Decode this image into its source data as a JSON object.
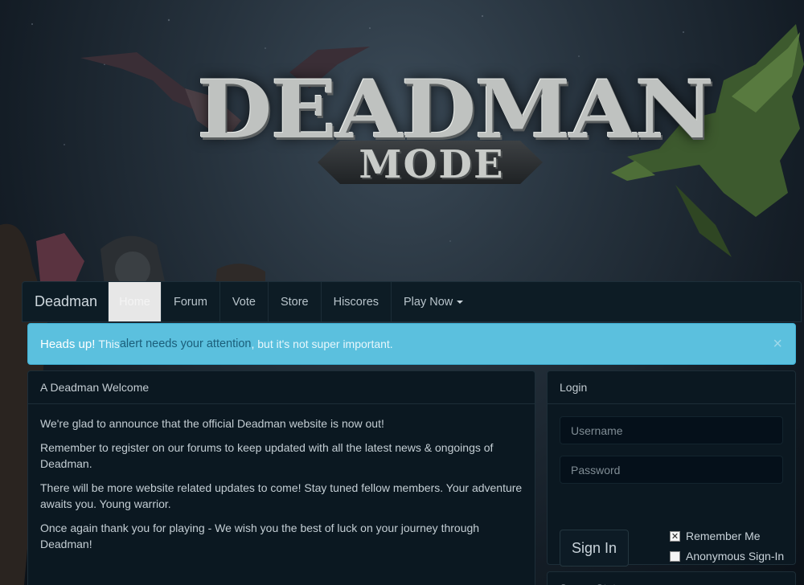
{
  "logo": {
    "title": "DEADMAN",
    "subtitle": "MODE"
  },
  "navbar": {
    "brand": "Deadman",
    "items": [
      {
        "label": "Home",
        "active": true
      },
      {
        "label": "Forum"
      },
      {
        "label": "Vote"
      },
      {
        "label": "Store"
      },
      {
        "label": "Hiscores"
      },
      {
        "label": "Play Now",
        "dropdown": true
      }
    ]
  },
  "alert": {
    "strong": "Heads up!",
    "text_before": " This ",
    "link": "alert needs your attention",
    "text_after": ", but it's not super important.",
    "close_icon": "×",
    "color": "#5bc0de"
  },
  "welcome": {
    "heading": "A Deadman Welcome",
    "paragraphs": [
      "We're glad to announce that the official Deadman website is now out!",
      "Remember to register on our forums to keep updated with all the latest news & ongoings of Deadman.",
      "There will be more website related updates to come! Stay tuned fellow members. Your adventure awaits you. Young warrior.",
      "Once again thank you for playing - We wish you the best of luck on your journey through Deadman!"
    ]
  },
  "login": {
    "heading": "Login",
    "username_placeholder": "Username",
    "password_placeholder": "Password",
    "signin_label": "Sign In",
    "remember_label": "Remember Me",
    "remember_checked": true,
    "anonymous_label": "Anonymous Sign-In",
    "anonymous_checked": false
  },
  "status": {
    "heading": "Server Status"
  }
}
